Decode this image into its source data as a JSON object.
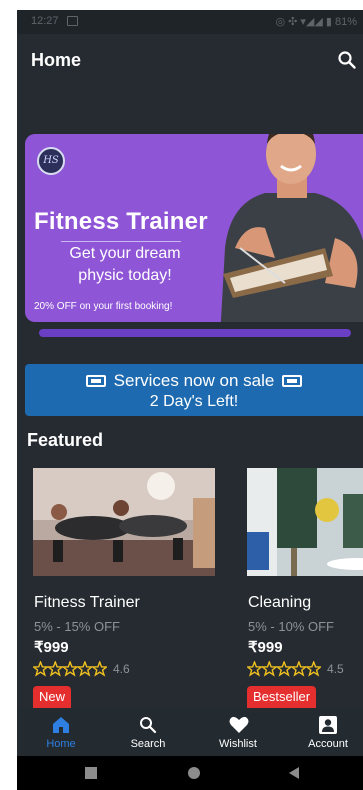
{
  "status_bar": {
    "time": "12:27",
    "indicators": "◎ ✣ ▾◢◢ ▮ 81%"
  },
  "app_bar": {
    "title": "Home",
    "search_icon": "search-icon"
  },
  "banner": {
    "logo": "HS",
    "title": "Fitness Trainer",
    "subtitle_line1": "Get your dream",
    "subtitle_line2": "physic today!",
    "offer": "20% OFF on your first booking!"
  },
  "sale_banner": {
    "line1": "Services now on sale",
    "line2": "2 Day's Left!"
  },
  "featured": {
    "heading": "Featured",
    "items": [
      {
        "name": "Fitness Trainer",
        "discount": "5% - 15% OFF",
        "price": "₹999",
        "rating": "4.6",
        "stars": 5,
        "badge": "New"
      },
      {
        "name": "Cleaning",
        "discount": "5% - 10% OFF",
        "price": "₹999",
        "rating": "4.5",
        "stars": 5,
        "badge": "Bestseller"
      }
    ]
  },
  "bottom_nav": {
    "items": [
      {
        "label": "Home",
        "icon": "home-icon",
        "active": true
      },
      {
        "label": "Search",
        "icon": "search-icon",
        "active": false
      },
      {
        "label": "Wishlist",
        "icon": "heart-icon",
        "active": false
      },
      {
        "label": "Account",
        "icon": "account-icon",
        "active": false
      }
    ]
  },
  "colors": {
    "background": "#252b30",
    "banner_purple": "#8e55d6",
    "sale_blue": "#1d6ab0",
    "badge_red": "#e52f2f",
    "star_gold": "#f0c020",
    "active_nav": "#2f7fe0"
  }
}
